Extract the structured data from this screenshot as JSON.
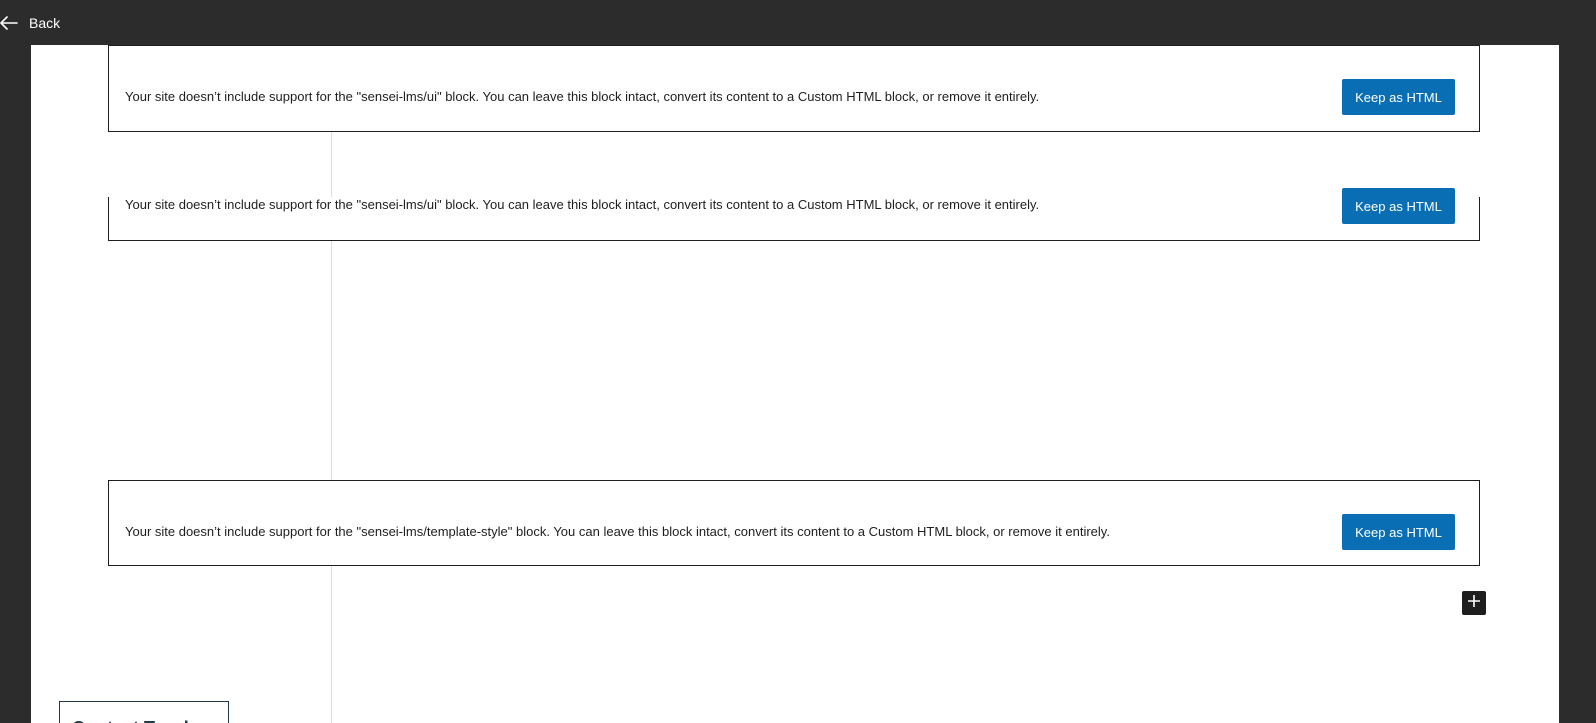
{
  "topbar": {
    "back_label": "Back",
    "back_icon": "arrow-left-icon"
  },
  "blocks": [
    {
      "message": "Your site doesn’t include support for the \"sensei-lms/ui\" block. You can leave this block intact, convert its content to a Custom HTML block, or remove it entirely.",
      "button_label": "Keep as HTML"
    },
    {
      "message": "Your site doesn’t include support for the \"sensei-lms/ui\" block. You can leave this block intact, convert its content to a Custom HTML block, or remove it entirely.",
      "button_label": "Keep as HTML"
    },
    {
      "message": "Your site doesn’t include support for the \"sensei-lms/template-style\" block. You can leave this block intact, convert its content to a Custom HTML block, or remove it entirely.",
      "button_label": "Keep as HTML"
    }
  ],
  "inserter": {
    "icon": "plus-icon"
  },
  "contact_button": {
    "label": "Contact Teacher"
  },
  "colors": {
    "chrome": "#2c2c2c",
    "canvas": "#ffffff",
    "accent": "#0a6eb4",
    "text": "#1e1e1e"
  }
}
